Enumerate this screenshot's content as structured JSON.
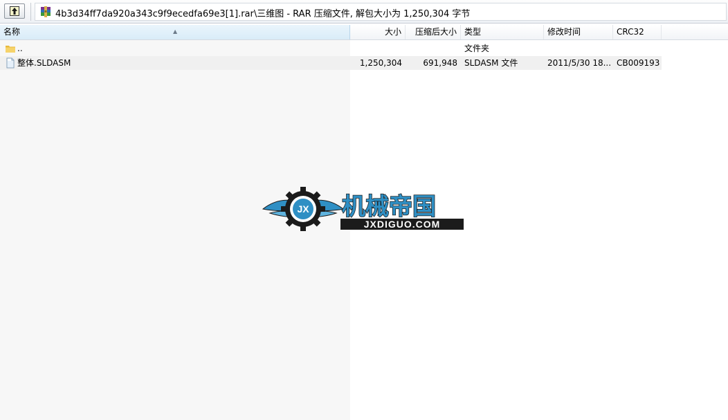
{
  "window": {
    "path_title": "4b3d34ff7da920a343c9f9ecedfa69e3[1].rar\\三维图 - RAR 压缩文件, 解包大小为 1,250,304 字节"
  },
  "toolbar": {
    "up_icon": "folder-up-icon",
    "archive_icon": "winrar-archive-icon"
  },
  "columns": {
    "name": "名称",
    "size": "大小",
    "packed": "压缩后大小",
    "type": "类型",
    "modified": "修改时间",
    "crc": "CRC32"
  },
  "rows": [
    {
      "name": "..",
      "size": "",
      "packed": "",
      "type": "文件夹",
      "modified": "",
      "crc": "",
      "icon": "folder-icon"
    },
    {
      "name": "整体.SLDASM",
      "size": "1,250,304",
      "packed": "691,948",
      "type": "SLDASM 文件",
      "modified": "2011/5/30 18...",
      "crc": "CB009193",
      "icon": "file-icon"
    }
  ],
  "watermark": {
    "logo_text": "机械帝国",
    "logo_subtext": "JXDIGUO.COM",
    "emblem_text": "JX",
    "colors": {
      "primary": "#2f8fc4",
      "dark": "#1b1b1b"
    }
  }
}
